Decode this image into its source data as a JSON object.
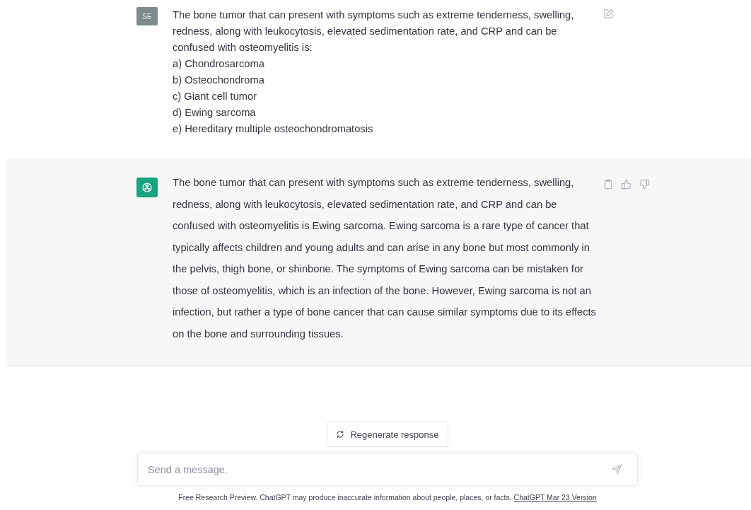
{
  "messages": [
    {
      "kind": "user",
      "avatar": "SE",
      "text": "The bone tumor that can present with symptoms such as extreme tenderness, swelling, redness, along with leukocytosis, elevated sedimentation rate, and CRP and can be confused with osteomyelitis is:",
      "options": [
        "a) Chondrosarcoma",
        "b) Osteochondroma",
        "c) Giant cell tumor",
        "d) Ewing sarcoma",
        "e) Hereditary multiple osteochondromatosis"
      ]
    },
    {
      "kind": "assistant",
      "text": "The bone tumor that can present with symptoms such as extreme tenderness, swelling, redness, along with leukocytosis, elevated sedimentation rate, and CRP and can be confused with osteomyelitis is Ewing sarcoma. Ewing sarcoma is a rare type of cancer that typically affects children and young adults and can arise in any bone but most commonly in the pelvis, thigh bone, or shinbone. The symptoms of Ewing sarcoma can be mistaken for those of osteomyelitis, which is an infection of the bone. However, Ewing sarcoma is not an infection, but rather a type of bone cancer that can cause similar symptoms due to its effects on the bone and surrounding tissues."
    }
  ],
  "regenerate_button": "Regenerate response",
  "composer": {
    "placeholder": "Send a message."
  },
  "footer": {
    "text": "Free Research Preview. ChatGPT may produce inaccurate information about people, places, or facts.",
    "link": "ChatGPT Mar 23 Version"
  }
}
